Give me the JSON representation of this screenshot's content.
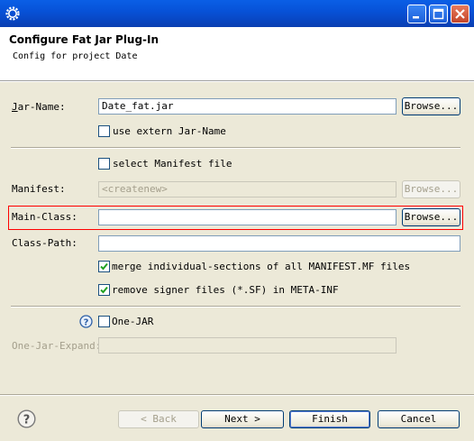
{
  "window": {
    "icon": "eclipse-gear-icon",
    "controls": [
      "minimize-icon",
      "maximize-icon",
      "close-icon"
    ]
  },
  "header": {
    "title": "Configure Fat Jar Plug-In",
    "subtitle": "Config for project Date"
  },
  "form": {
    "jar_name": {
      "label": "Jar-Name:",
      "value": "Date_fat.jar",
      "browse": "Browse..."
    },
    "extern_jar_name": {
      "label": "use extern Jar-Name",
      "checked": false
    },
    "select_manifest": {
      "label": "select Manifest file",
      "checked": false
    },
    "manifest": {
      "label": "Manifest:",
      "value": "<createnew>",
      "browse": "Browse..."
    },
    "main_class": {
      "label": "Main-Class:",
      "value": "",
      "browse": "Browse..."
    },
    "class_path": {
      "label": "Class-Path:",
      "value": ""
    },
    "merge_sections": {
      "label": "merge individual-sections of all MANIFEST.MF files",
      "checked": true
    },
    "remove_signer": {
      "label": "remove signer files (*.SF) in META-INF",
      "checked": true
    },
    "one_jar": {
      "label": "One-JAR",
      "checked": false
    },
    "one_jar_expand": {
      "label": "One-Jar-Expand:",
      "value": ""
    }
  },
  "footer": {
    "back": "< Back",
    "next": "Next >",
    "finish": "Finish",
    "cancel": "Cancel"
  },
  "colors": {
    "titlebar": "#0752d8",
    "dialog_bg": "#ece9d8",
    "highlight_border": "#ff0000",
    "check_mark": "#21a121"
  }
}
